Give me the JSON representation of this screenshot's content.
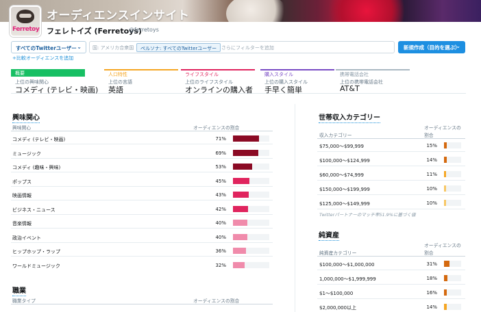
{
  "header": {
    "title": "オーディエンスインサイト",
    "account_name": "フェレトイズ (Ferretoys)",
    "account_handle": "@ferretoys",
    "avatar_logo_text": "Ferretoys"
  },
  "filters": {
    "audience_label": "すべてのTwitterユーザー",
    "country": "国: アメリカ合衆国",
    "persona_chip": "ペルソナ: すべてのTwitterユーザー",
    "placeholder": "さらにフィルターを追加",
    "new_button": "新規作成（目的を選ぶ）",
    "compare_link": "+比較オーディエンスを追加"
  },
  "cards": [
    {
      "tab": "概要",
      "sub": "上位の興味関心",
      "value": "コメディ (テレビ・映画)"
    },
    {
      "tab": "人口特性",
      "sub": "上位の言語",
      "value": "英語"
    },
    {
      "tab": "ライフスタイル",
      "sub": "上位のライフスタイル",
      "value": "オンラインの購入者"
    },
    {
      "tab": "購入スタイル",
      "sub": "上位の購入スタイル",
      "value": "手早く簡単"
    },
    {
      "tab": "携帯電話会社",
      "sub": "上位の携帯電話会社",
      "value": "AT&T"
    }
  ],
  "interests": {
    "title": "興味関心",
    "col_label": "興味関心",
    "col_pct": "オーディエンスの割合",
    "rows": [
      {
        "label": "コメディ (テレビ・映画)",
        "pct": "71%",
        "value": 71
      },
      {
        "label": "ミュージック",
        "pct": "69%",
        "value": 69
      },
      {
        "label": "コメディ (趣味・興味)",
        "pct": "53%",
        "value": 53
      },
      {
        "label": "ポップス",
        "pct": "45%",
        "value": 45
      },
      {
        "label": "映画情報",
        "pct": "43%",
        "value": 43
      },
      {
        "label": "ビジネス・ニュース",
        "pct": "42%",
        "value": 42
      },
      {
        "label": "音楽情報",
        "pct": "40%",
        "value": 40
      },
      {
        "label": "政治イベント",
        "pct": "40%",
        "value": 40
      },
      {
        "label": "ヒップホップ・ラップ",
        "pct": "36%",
        "value": 36
      },
      {
        "label": "ワールドミュージック",
        "pct": "32%",
        "value": 32
      }
    ],
    "colors": [
      "#8b0a24",
      "#8b0a24",
      "#8b0a24",
      "#e0245e",
      "#e0245e",
      "#e0245e",
      "#f08bab",
      "#f08bab",
      "#f08bab",
      "#f08bab"
    ]
  },
  "occupation": {
    "title": "職業",
    "col_label": "職業タイプ",
    "col_pct": "オーディエンスの割合"
  },
  "income": {
    "title": "世帯収入カテゴリー",
    "col_label": "収入カテゴリー",
    "col_pct_line1": "オーディエンスの",
    "col_pct_line2": "割合",
    "rows": [
      {
        "label": "$75,000〜$99,999",
        "pct": "15%",
        "value": 15
      },
      {
        "label": "$100,000〜$124,999",
        "pct": "14%",
        "value": 14
      },
      {
        "label": "$60,000〜$74,999",
        "pct": "11%",
        "value": 11
      },
      {
        "label": "$150,000〜$199,999",
        "pct": "10%",
        "value": 10
      },
      {
        "label": "$125,000〜$149,999",
        "pct": "10%",
        "value": 10
      }
    ],
    "colors": [
      "#d4690e",
      "#d4690e",
      "#f5a623",
      "#f7c765",
      "#f7c765"
    ],
    "note": "Twitterパートナーのマッチ率51.9%に基づく値"
  },
  "net_worth": {
    "title": "純資産",
    "col_label": "純資産カテゴリー",
    "col_pct_line1": "オーディエンスの",
    "col_pct_line2": "割合",
    "rows": [
      {
        "label": "$100,000〜$1,000,000",
        "pct": "31%",
        "value": 31
      },
      {
        "label": "1,000,000〜$1,999,999",
        "pct": "18%",
        "value": 18
      },
      {
        "label": "$1〜$100,000",
        "pct": "16%",
        "value": 16
      },
      {
        "label": "$2,000,000以上",
        "pct": "14%",
        "value": 14
      }
    ],
    "colors": [
      "#d4690e",
      "#d4690e",
      "#d4690e",
      "#f5a623"
    ]
  }
}
